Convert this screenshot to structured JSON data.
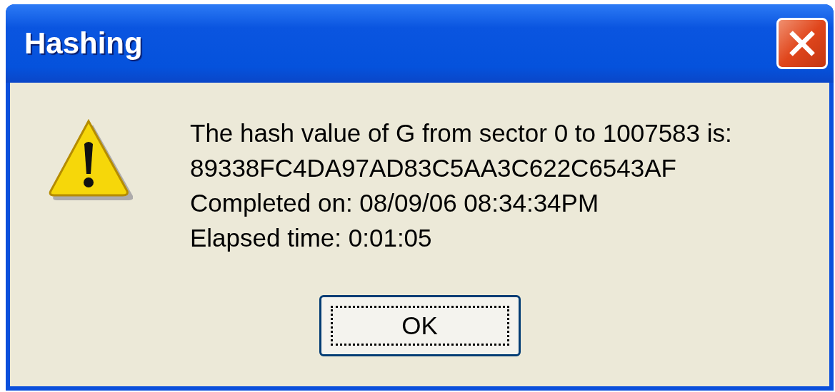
{
  "window": {
    "title": "Hashing"
  },
  "message": {
    "kind": "warning",
    "lines": [
      "The hash value of G from sector 0 to 1007583 is:",
      "89338FC4DA97AD83C5AA3C622C6543AF",
      "Completed on: 08/09/06 08:34:34PM",
      "Elapsed time: 0:01:05"
    ]
  },
  "buttons": [
    {
      "label": "OK",
      "focused": true
    }
  ]
}
